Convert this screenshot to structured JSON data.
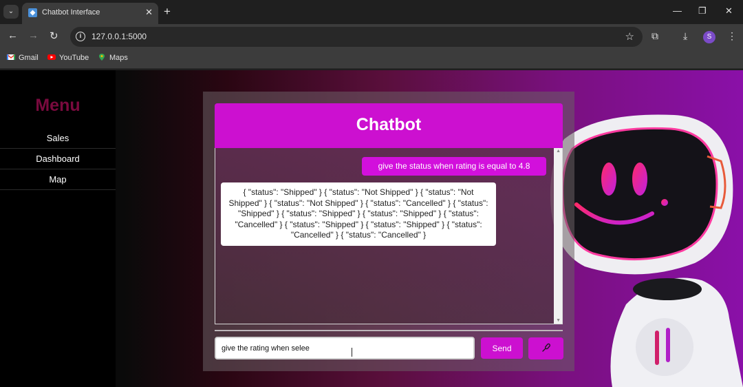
{
  "browser": {
    "tab_title": "Chatbot Interface",
    "tab_close": "✕",
    "new_tab": "+",
    "url": "127.0.0.1:5000",
    "profile_initial": "S",
    "bookmarks": [
      {
        "label": "Gmail",
        "icon": "gmail-icon"
      },
      {
        "label": "YouTube",
        "icon": "youtube-icon"
      },
      {
        "label": "Maps",
        "icon": "maps-icon"
      }
    ]
  },
  "sidebar": {
    "title": "Menu",
    "items": [
      {
        "label": "Sales"
      },
      {
        "label": "Dashboard"
      },
      {
        "label": "Map"
      }
    ]
  },
  "chat": {
    "title": "Chatbot",
    "messages": [
      {
        "role": "user",
        "text": "give the status when rating is equal to 4.8"
      },
      {
        "role": "bot",
        "text": "{ \"status\": \"Shipped\" } { \"status\": \"Not Shipped\" } { \"status\": \"Not Shipped\" } { \"status\": \"Not Shipped\" } { \"status\": \"Cancelled\" } { \"status\": \"Shipped\" } { \"status\": \"Shipped\" } { \"status\": \"Shipped\" } { \"status\": \"Cancelled\" } { \"status\": \"Shipped\" } { \"status\": \"Shipped\" } { \"status\": \"Cancelled\" } { \"status\": \"Cancelled\" }"
      }
    ],
    "input_value": "give the rating when selee",
    "send_label": "Send",
    "mic_icon": "microphone-icon"
  },
  "colors": {
    "accent": "#cc10d0",
    "menu_title": "#7a0a3e",
    "sidebar_bg": "#000000"
  }
}
